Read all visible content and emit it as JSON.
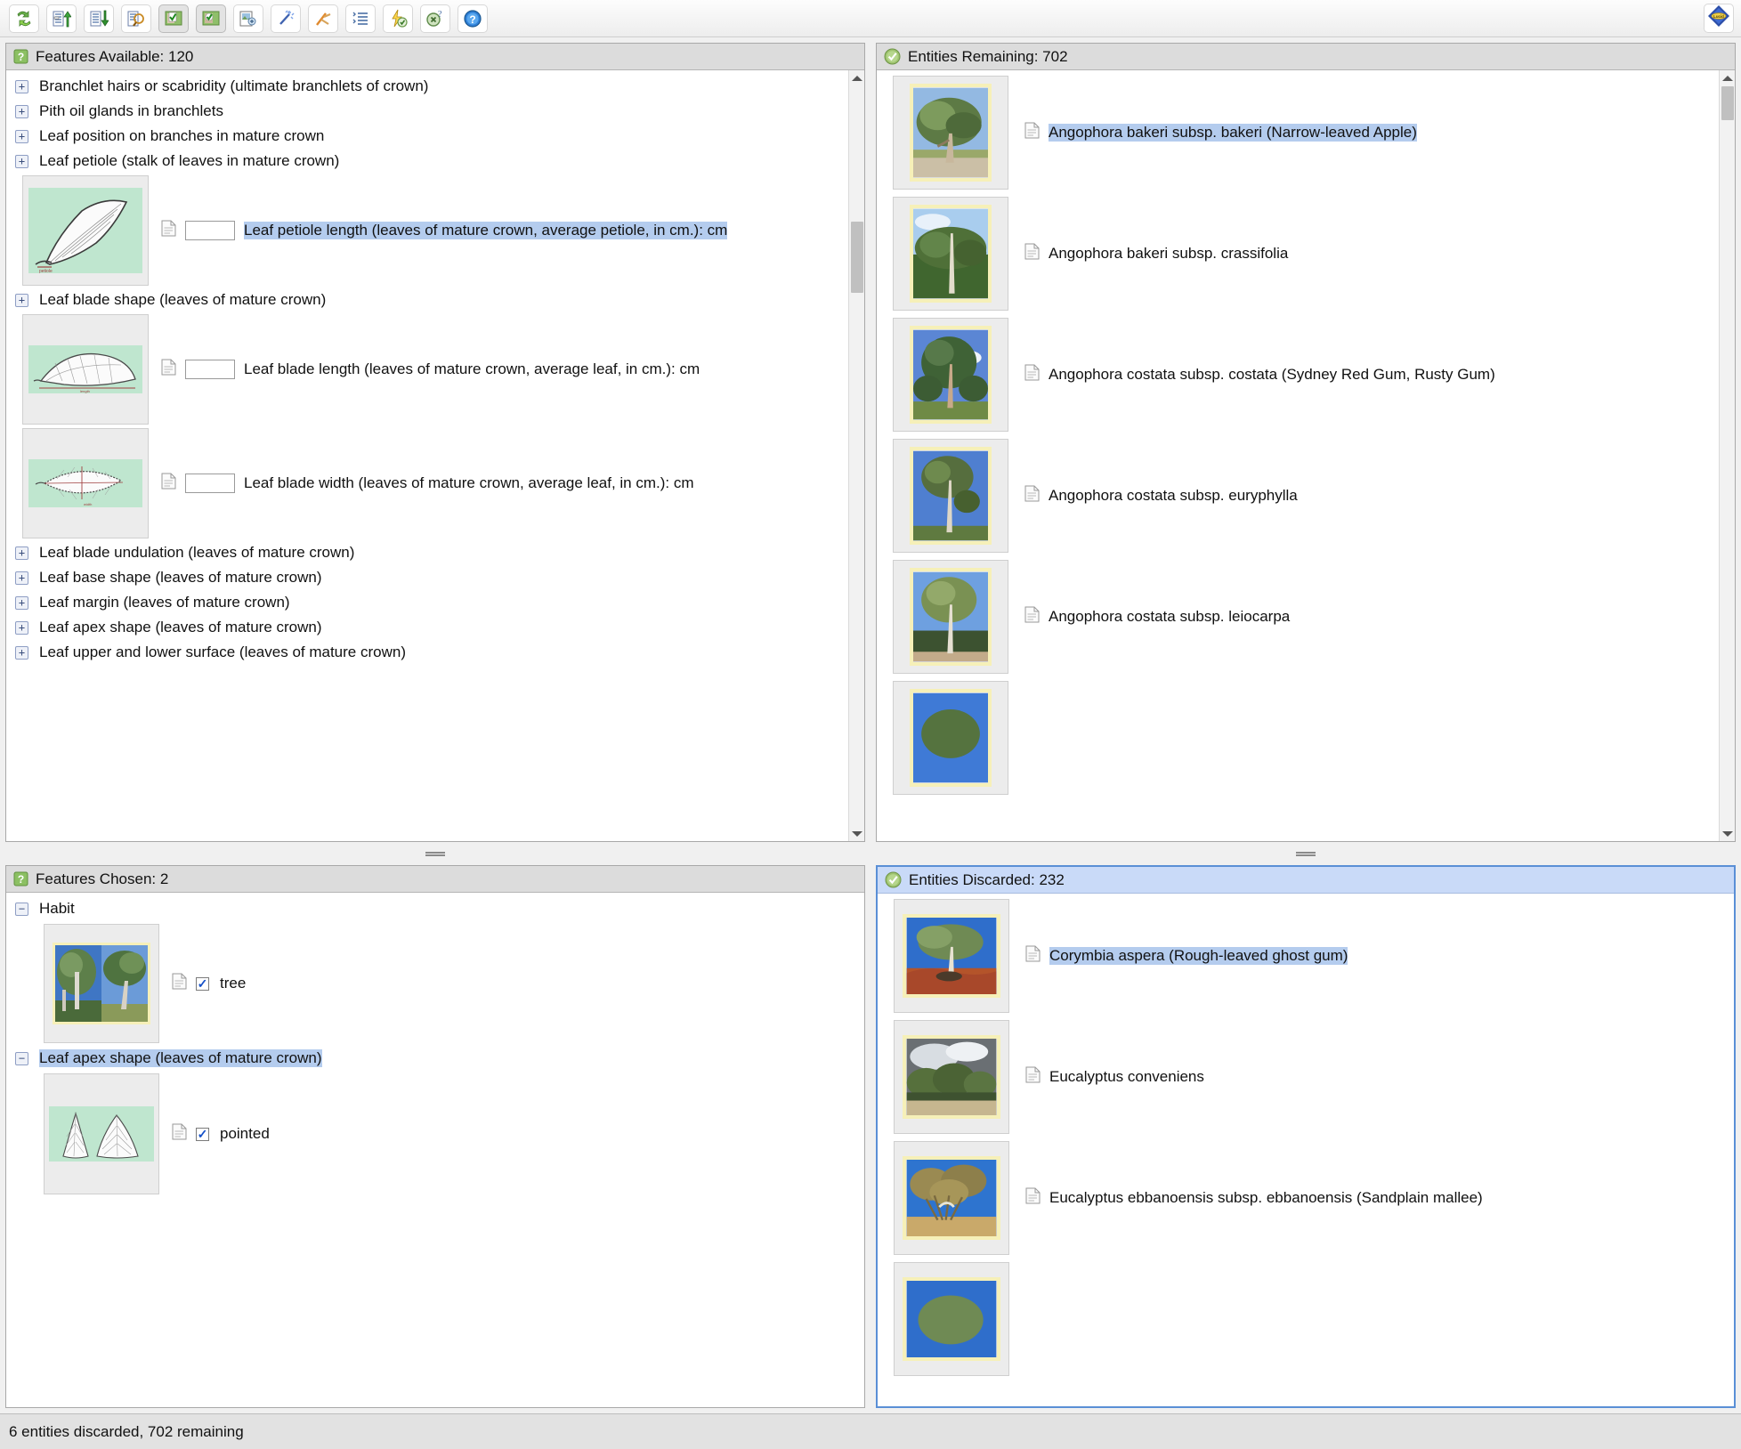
{
  "toolbar": {
    "buttons": [
      {
        "name": "restart-icon",
        "label": "Restart"
      },
      {
        "name": "prev-feature-icon",
        "label": "Previous feature"
      },
      {
        "name": "next-feature-icon",
        "label": "Next feature"
      },
      {
        "name": "find-icon",
        "label": "Find"
      },
      {
        "name": "features-chosen-icon",
        "label": "Features chosen",
        "pressed": true
      },
      {
        "name": "entities-discarded-icon",
        "label": "Entities discarded",
        "pressed": true
      },
      {
        "name": "differences-icon",
        "label": "Differences"
      },
      {
        "name": "best-feature-icon",
        "label": "Best feature"
      },
      {
        "name": "prune-icon",
        "label": "Prune redundant features"
      },
      {
        "name": "subset-icon",
        "label": "Subset"
      },
      {
        "name": "tolerance-icon",
        "label": "Set tolerance"
      },
      {
        "name": "discard-icon",
        "label": "Discard"
      },
      {
        "name": "help-icon",
        "label": "Help"
      }
    ],
    "logo": {
      "name": "lucid-logo-icon",
      "label": "Lucid"
    }
  },
  "panels": {
    "features_available": {
      "title": "Features Available: 120",
      "items": [
        {
          "kind": "node",
          "expander": "+",
          "label": "Branchlet hairs or scabridity (ultimate branchlets of crown)",
          "selected": false
        },
        {
          "kind": "node",
          "expander": "+",
          "label": "Pith oil glands in branchlets",
          "selected": false
        },
        {
          "kind": "node",
          "expander": "+",
          "label": "Leaf position on branches in mature crown",
          "selected": false
        },
        {
          "kind": "node",
          "expander": "+",
          "label": "Leaf petiole (stalk of leaves in mature crown)",
          "selected": false
        },
        {
          "kind": "numeric",
          "image": "leaf-petiole-diagram",
          "input_value": "",
          "label": "Leaf petiole length (leaves of mature crown, average petiole, in cm.): cm",
          "selected": true
        },
        {
          "kind": "node",
          "expander": "+",
          "label": "Leaf blade shape (leaves of mature crown)",
          "selected": false
        },
        {
          "kind": "numeric",
          "image": "leaf-blade-length-diagram",
          "input_value": "",
          "label": "Leaf blade length (leaves of mature crown, average leaf, in cm.): cm",
          "selected": false
        },
        {
          "kind": "numeric",
          "image": "leaf-blade-width-diagram",
          "input_value": "",
          "label": "Leaf blade width (leaves of mature crown, average leaf, in cm.): cm",
          "selected": false
        },
        {
          "kind": "node",
          "expander": "+",
          "label": "Leaf blade undulation (leaves of mature crown)",
          "selected": false
        },
        {
          "kind": "node",
          "expander": "+",
          "label": "Leaf base shape (leaves of mature crown)",
          "selected": false
        },
        {
          "kind": "node",
          "expander": "+",
          "label": "Leaf margin (leaves of mature crown)",
          "selected": false
        },
        {
          "kind": "node",
          "expander": "+",
          "label": "Leaf apex shape (leaves of mature crown)",
          "selected": false
        },
        {
          "kind": "node",
          "expander": "+",
          "label": "Leaf upper and lower surface (leaves of mature crown)",
          "selected": false
        }
      ]
    },
    "features_chosen": {
      "title": "Features Chosen: 2",
      "items": [
        {
          "kind": "node",
          "expander": "−",
          "label": "Habit",
          "selected": false
        },
        {
          "kind": "state",
          "image": "habit-two-tree-photos",
          "checked": true,
          "label": "tree"
        },
        {
          "kind": "node",
          "expander": "−",
          "label": "Leaf apex shape (leaves of mature crown)",
          "selected": true
        },
        {
          "kind": "state",
          "image": "leaf-apex-pointed-diagram",
          "checked": true,
          "label": "pointed"
        }
      ]
    },
    "entities_remaining": {
      "title": "Entities Remaining: 702",
      "items": [
        {
          "label": "Angophora bakeri subsp. bakeri (Narrow-leaved Apple)",
          "selected": true,
          "photo": "tree-on-sandy-track"
        },
        {
          "label": "Angophora bakeri subsp. crassifolia",
          "selected": false,
          "photo": "tall-pale-trunk-tree"
        },
        {
          "label": "Angophora costata subsp. costata (Sydney Red Gum, Rusty Gum)",
          "selected": false,
          "photo": "tall-tree-blue-sky"
        },
        {
          "label": "Angophora costata subsp. euryphylla",
          "selected": false,
          "photo": "slender-tree-blue-sky"
        },
        {
          "label": "Angophora costata subsp. leiocarpa",
          "selected": false,
          "photo": "gum-tree-dry-ground"
        }
      ]
    },
    "entities_discarded": {
      "title": "Entities Discarded: 232",
      "items": [
        {
          "label": "Corymbia aspera (Rough-leaved ghost gum)",
          "selected": true,
          "photo": "ghost-gum-red-soil"
        },
        {
          "label": "Eucalyptus conveniens",
          "selected": false,
          "photo": "trees-stormy-sky"
        },
        {
          "label": "Eucalyptus ebbanoensis subsp. ebbanoensis (Sandplain mallee)",
          "selected": false,
          "photo": "mallee-dry-scrub"
        }
      ]
    }
  },
  "statusbar": {
    "message": "6 entities discarded, 702 remaining"
  },
  "colors": {
    "selection": "#b4ccee",
    "header": "#dcdcdc",
    "header_focused": "#c9daf8",
    "diagram_green": "#bfe6cf",
    "photo_border": "#f6f0b8"
  }
}
